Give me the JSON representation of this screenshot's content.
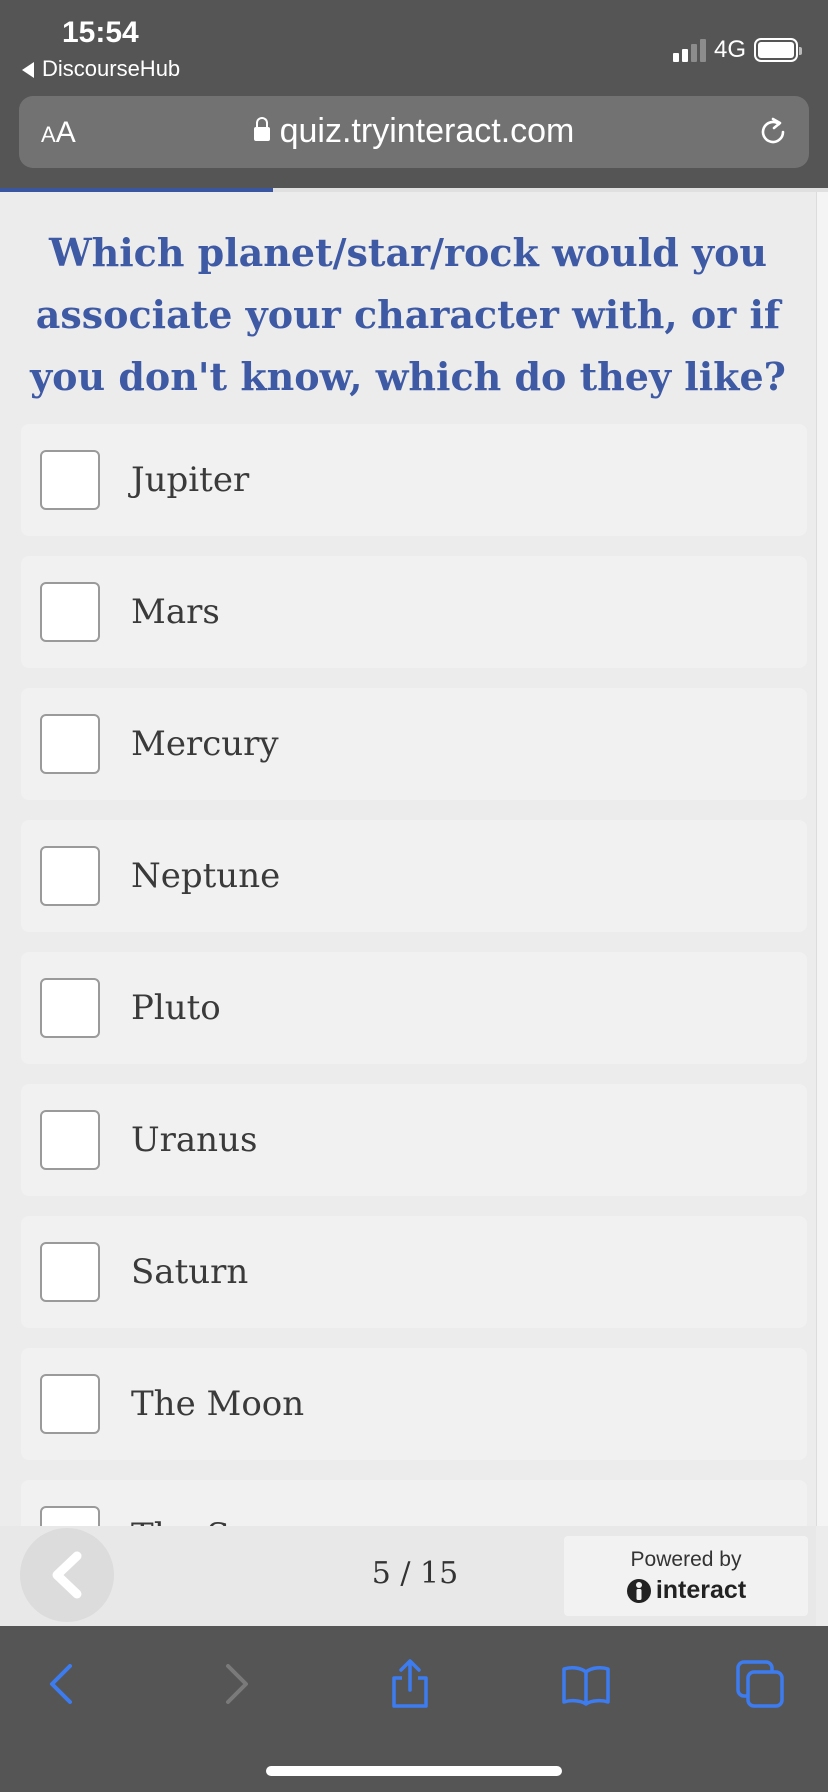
{
  "status_bar": {
    "time": "15:54",
    "back_app_label": "DiscourseHub",
    "network": "4G",
    "icons": [
      "signal-icon",
      "battery-icon"
    ]
  },
  "browser": {
    "text_size_small": "A",
    "text_size_big": "A",
    "url": "quiz.tryinteract.com",
    "icons": [
      "lock-icon",
      "reload-icon"
    ]
  },
  "quiz": {
    "progress_fraction": 0.33,
    "question": "Which planet/star/rock would you associate your character with, or if you don't know, which do they like?",
    "options": [
      {
        "label": "Jupiter",
        "checked": false
      },
      {
        "label": "Mars",
        "checked": false
      },
      {
        "label": "Mercury",
        "checked": false
      },
      {
        "label": "Neptune",
        "checked": false
      },
      {
        "label": "Pluto",
        "checked": false
      },
      {
        "label": "Uranus",
        "checked": false
      },
      {
        "label": "Saturn",
        "checked": false
      },
      {
        "label": "The Moon",
        "checked": false
      },
      {
        "label": "The Sun",
        "checked": false
      }
    ],
    "pager": "5 / 15",
    "powered_by": "Powered by",
    "brand": "interact"
  },
  "toolbar": {
    "icons": [
      "back-icon",
      "forward-icon",
      "share-icon",
      "bookmarks-icon",
      "tabs-icon"
    ]
  },
  "colors": {
    "accent": "#3f5aa5",
    "chrome": "#555555",
    "ios_blue": "#3d7cf0"
  }
}
